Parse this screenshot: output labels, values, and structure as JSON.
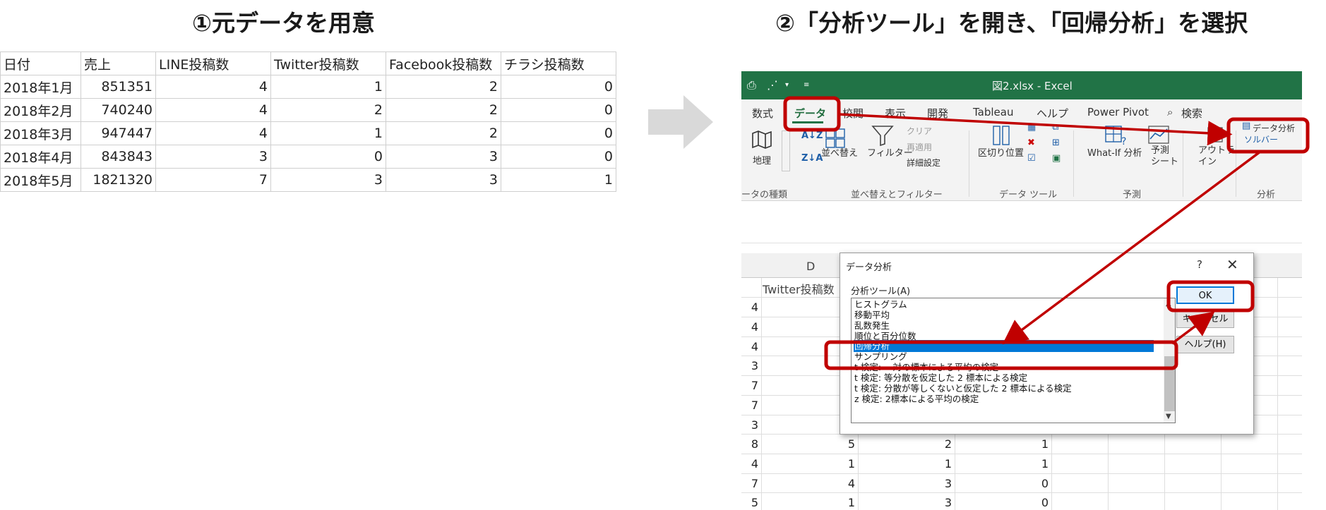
{
  "left_title": "①元データを用意",
  "right_title": "②「分析ツール」を開き、「回帰分析」を選択",
  "raw_table": {
    "headers": [
      "日付",
      "売上",
      "LINE投稿数",
      "Twitter投稿数",
      "Facebook投稿数",
      "チラシ投稿数"
    ],
    "rows": [
      [
        "2018年1月",
        "851351",
        "4",
        "1",
        "2",
        "0"
      ],
      [
        "2018年2月",
        "740240",
        "4",
        "2",
        "2",
        "0"
      ],
      [
        "2018年3月",
        "947447",
        "4",
        "1",
        "2",
        "0"
      ],
      [
        "2018年4月",
        "843843",
        "3",
        "0",
        "3",
        "0"
      ],
      [
        "2018年5月",
        "1821320",
        "7",
        "3",
        "3",
        "1"
      ]
    ]
  },
  "excel": {
    "window_title": "図2.xlsx  -  Excel",
    "tabs": [
      "数式",
      "データ",
      "校閲",
      "表示",
      "開発",
      "Tableau",
      "ヘルプ",
      "Power Pivot",
      "検索"
    ],
    "active_tab": "データ",
    "ribbon": {
      "geo_label": "地理",
      "sort_label": "並べ替え",
      "filter_label": "フィルター",
      "clear_label": "クリア",
      "reapply_label": "再適用",
      "advanced_label": "詳細設定",
      "text_to_columns_label": "区切り位置",
      "whatif_label": "What-If 分析",
      "forecast_label": "予測\nシート",
      "addin_label": "アウトラ\nイン",
      "data_analysis_label": "データ分析",
      "solver_label": "ソルバー",
      "groups": {
        "datatypes": "ータの種類",
        "sortfilter": "並べ替えとフィルター",
        "datatools": "データ ツール",
        "forecast": "予測",
        "analysis": "分析"
      }
    },
    "grid": {
      "col_letter": "D",
      "header_cell": "Twitter投稿数",
      "rows_left": [
        "4",
        "4",
        "4",
        "3",
        "7",
        "7",
        "3",
        "8",
        "4",
        "7",
        "5"
      ],
      "rows_bottom": [
        [
          "5",
          "2",
          "1"
        ],
        [
          "1",
          "1",
          "1"
        ],
        [
          "4",
          "3",
          "0"
        ],
        [
          "1",
          "3",
          "0"
        ]
      ]
    },
    "dialog": {
      "title": "データ分析",
      "help": "?",
      "close": "✕",
      "tool_label": "分析ツール(A)",
      "items": [
        "ヒストグラム",
        "移動平均",
        "乱数発生",
        "順位と百分位数",
        "回帰分析",
        "サンプリング",
        "t 検定:  一対の標本による平均の検定",
        "t 検定:  等分散を仮定した 2 標本による検定",
        "t 検定:  分散が等しくないと仮定した 2 標本による検定",
        "z 検定:  2標本による平均の検定"
      ],
      "selected": "回帰分析",
      "ok": "OK",
      "cancel": "キャンセル",
      "help_button": "ヘルプ(H)"
    }
  },
  "colors": {
    "excel_green": "#217346",
    "annotation_red": "#c00000",
    "selection_blue": "#0078d7",
    "arrow_grey": "#d9d9d9"
  }
}
